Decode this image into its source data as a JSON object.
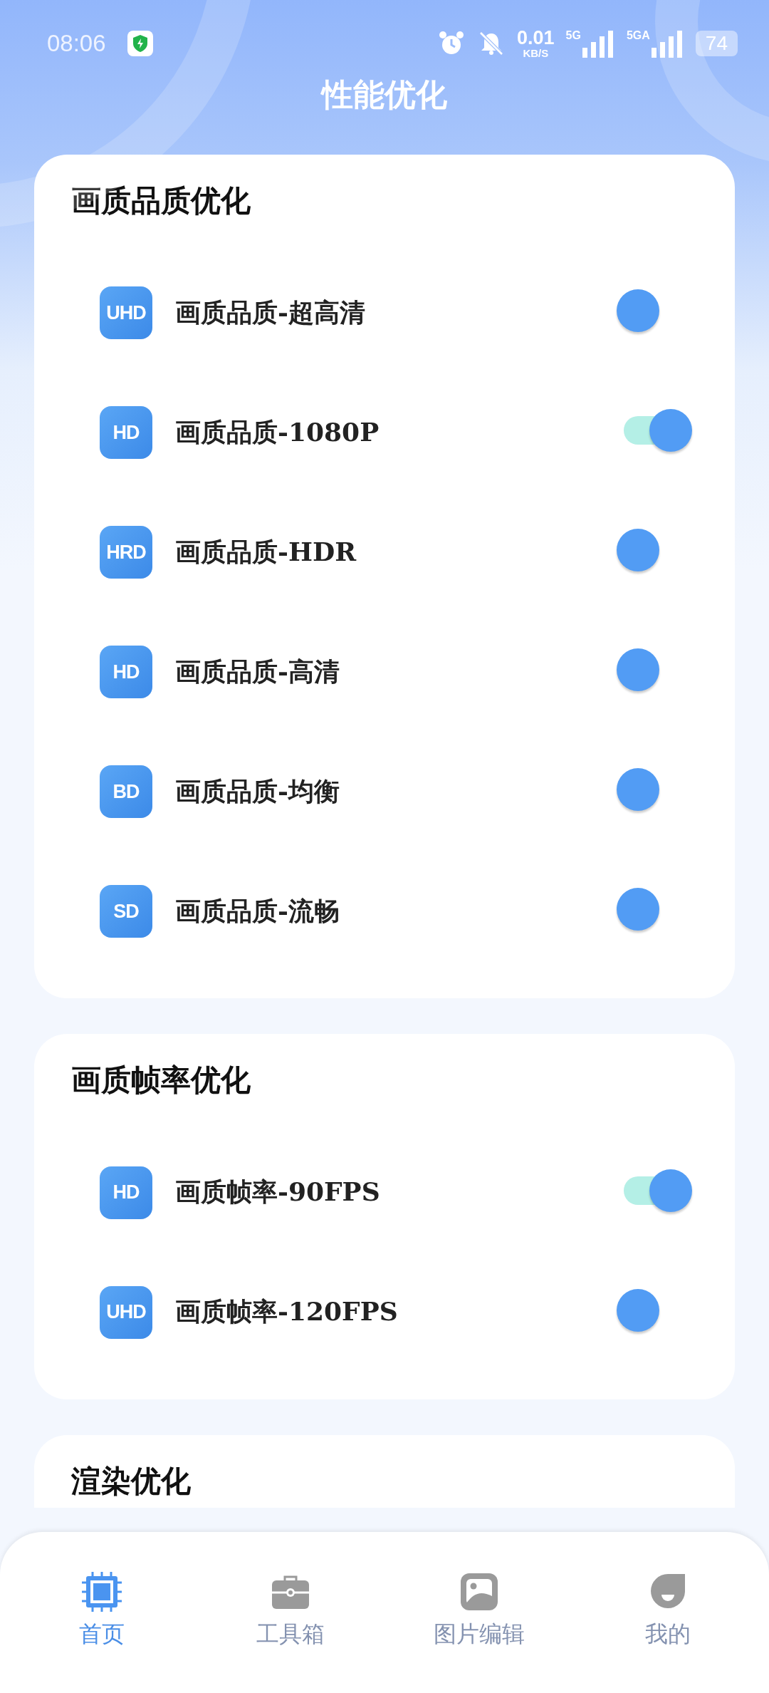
{
  "status_bar": {
    "time": "08:06",
    "speed": "0.01",
    "speed_unit": "KB/S",
    "network_1": "5G",
    "network_2": "5GA",
    "battery": "74"
  },
  "header": {
    "title": "性能优化"
  },
  "sections": [
    {
      "title": "画质品质优化",
      "items": [
        {
          "badge": "UHD",
          "label": "画质品质-超高清",
          "on": false
        },
        {
          "badge": "HD",
          "label": "画质品质-1080P",
          "on": true
        },
        {
          "badge": "HRD",
          "label": "画质品质-HDR",
          "on": false
        },
        {
          "badge": "HD",
          "label": "画质品质-高清",
          "on": false
        },
        {
          "badge": "BD",
          "label": "画质品质-均衡",
          "on": false
        },
        {
          "badge": "SD",
          "label": "画质品质-流畅",
          "on": false
        }
      ]
    },
    {
      "title": "画质帧率优化",
      "items": [
        {
          "badge": "HD",
          "label": "画质帧率-90FPS",
          "on": true
        },
        {
          "badge": "UHD",
          "label": "画质帧率-120FPS",
          "on": false
        }
      ]
    },
    {
      "title": "渲染优化"
    }
  ],
  "nav": [
    {
      "kind": "chip",
      "label": "首页",
      "selected": true
    },
    {
      "kind": "toolbox",
      "label": "工具箱",
      "selected": false
    },
    {
      "kind": "image",
      "label": "图片编辑",
      "selected": false
    },
    {
      "kind": "face",
      "label": "我的",
      "selected": false
    }
  ]
}
